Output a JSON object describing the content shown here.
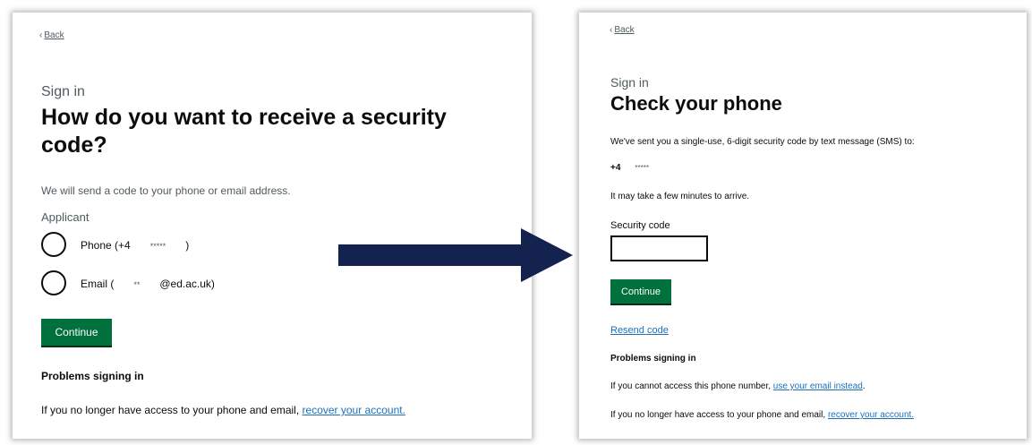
{
  "left": {
    "back_label": "Back",
    "caption": "Sign in",
    "heading_line1": "How do you want to receive a security",
    "heading_line2": "code?",
    "hint": "We will send a code to your phone or email address.",
    "fieldset_legend": "Applicant",
    "options": [
      {
        "label": "Phone (+4",
        "masked": "*****",
        "suffix": ")"
      },
      {
        "label": "Email (",
        "masked": "**",
        "suffix": "@ed.ac.uk)"
      }
    ],
    "continue_label": "Continue",
    "problems_heading": "Problems signing in",
    "problems_text": "If you no longer have access to your phone and email,",
    "recover_link": "recover your account."
  },
  "right": {
    "back_label": "Back",
    "caption": "Sign in",
    "heading": "Check your phone",
    "sent_text": "We've sent you a single-use, 6-digit security code by text message (SMS) to:",
    "phone_prefix": "+4",
    "phone_masked": "*****",
    "arrive_text": "It may take a few minutes to arrive.",
    "code_label": "Security code",
    "code_value": "",
    "continue_label": "Continue",
    "resend_link": "Resend code",
    "problems_heading": "Problems signing in",
    "no_phone_text": "If you cannot access this phone number,",
    "use_email_link": "use your email instead",
    "no_phone_end": ".",
    "problems_text": "If you no longer have access to your phone and email,",
    "recover_link": "recover your account."
  },
  "colors": {
    "button_green": "#00703c",
    "link_blue": "#1d70b8",
    "arrow_navy": "#14224f",
    "text": "#0b0c0c",
    "muted": "#505a5f"
  },
  "icons": {
    "back": "chevron-left-icon",
    "flow": "arrow-right-icon"
  }
}
